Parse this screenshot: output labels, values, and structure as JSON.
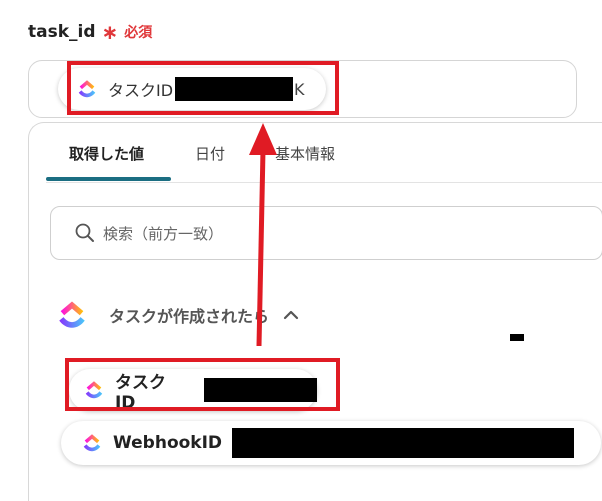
{
  "field": {
    "name": "task_id",
    "required_mark": "∗",
    "required_text": "必須"
  },
  "input_chip": {
    "label": "タスクID",
    "tail_glyph": "K"
  },
  "tabs": [
    {
      "label": "取得した値",
      "active": true
    },
    {
      "label": "日付",
      "active": false
    },
    {
      "label": "基本情報",
      "active": false
    }
  ],
  "search": {
    "placeholder": "検索（前方一致）"
  },
  "section": {
    "title": "タスクが作成されたら",
    "expanded": true
  },
  "values": [
    {
      "label": "タスクID"
    },
    {
      "label": "WebhookID"
    }
  ],
  "colors": {
    "accent": "#1b6e82",
    "highlight": "#e01b24",
    "required": "#e0373a"
  },
  "icons": {
    "app": "clickup-logo",
    "search": "search-icon",
    "collapse": "chevron-up-icon",
    "annotation": "red-arrow"
  }
}
